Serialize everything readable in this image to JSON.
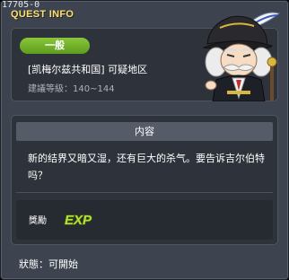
{
  "window": {
    "quest_id": "17705-0",
    "title": "QUEST INFO"
  },
  "quest": {
    "category": "一般",
    "name": "[凯梅尔兹共和国] 可疑地区",
    "level": "建議等級：140~144"
  },
  "content": {
    "header": "内容",
    "description": "新的结界又暗又湿，还有巨大的杀气。要告诉吉尔伯特吗？"
  },
  "reward": {
    "label": "獎勵",
    "exp_text": "EXP",
    "exp_icon": "exp-icon"
  },
  "status": {
    "text": "狀態：可開始"
  },
  "npc": {
    "icon": "npc-portrait"
  },
  "colors": {
    "title": "#ffe06a",
    "badge": "#7ab633",
    "exp": "#b6e03c"
  }
}
